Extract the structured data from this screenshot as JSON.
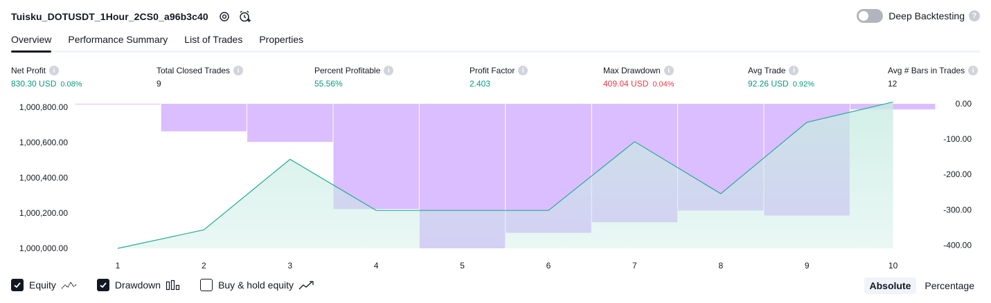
{
  "header": {
    "strategy_name": "Tuisku_DOTUSDT_1Hour_2CS0_a96b3c40",
    "deep_backtesting_label": "Deep Backtesting",
    "help_glyph": "?"
  },
  "tabs": [
    {
      "label": "Overview",
      "active": true
    },
    {
      "label": "Performance Summary",
      "active": false
    },
    {
      "label": "List of Trades",
      "active": false
    },
    {
      "label": "Properties",
      "active": false
    }
  ],
  "metrics": [
    {
      "label": "Net Profit",
      "value": "830.30 USD",
      "pct": "0.08%",
      "tone": "pos"
    },
    {
      "label": "Total Closed Trades",
      "value": "9",
      "pct": "",
      "tone": "plain"
    },
    {
      "label": "Percent Profitable",
      "value": "55.56%",
      "pct": "",
      "tone": "pos"
    },
    {
      "label": "Profit Factor",
      "value": "2.403",
      "pct": "",
      "tone": "pos"
    },
    {
      "label": "Max Drawdown",
      "value": "409.04 USD",
      "pct": "0.04%",
      "tone": "neg"
    },
    {
      "label": "Avg Trade",
      "value": "92.26 USD",
      "pct": "0.92%",
      "tone": "pos"
    },
    {
      "label": "Avg # Bars in Trades",
      "value": "12",
      "pct": "",
      "tone": "plain"
    }
  ],
  "metric_info_glyph": "i",
  "chart_data": {
    "type": "area",
    "x": [
      1,
      2,
      3,
      4,
      5,
      6,
      7,
      8,
      9,
      10
    ],
    "x_tick_labels": [
      "1",
      "2",
      "3",
      "4",
      "5",
      "6",
      "7",
      "8",
      "9",
      "10"
    ],
    "series": [
      {
        "axis": "left",
        "kind": "area-line",
        "values": [
          1000000,
          1000105,
          1000505,
          1000215,
          1000215,
          1000215,
          1000605,
          1000310,
          1000715,
          1000830
        ]
      },
      {
        "axis": "right",
        "kind": "bar",
        "values": [
          0,
          -78,
          -108,
          -298,
          -409,
          -365,
          -335,
          -302,
          -316,
          -16
        ]
      }
    ],
    "left_axis": {
      "ylim": [
        1000000,
        1000820
      ],
      "ticks": [
        1000000,
        1000200,
        1000400,
        1000600,
        1000800
      ],
      "tick_labels": [
        "1,000,000.00",
        "1,000,200.00",
        "1,000,400.00",
        "1,000,600.00",
        "1,000,800.00"
      ]
    },
    "right_axis": {
      "ylim": [
        -409,
        0
      ],
      "ticks": [
        0,
        -100,
        -200,
        -300,
        -400
      ],
      "tick_labels": [
        "0.00",
        "-100.00",
        "-200.00",
        "-300.00",
        "-400.00"
      ]
    },
    "colors": {
      "equity_line": "#22ab94",
      "equity_fill": "#c8ece2",
      "drawdown": "#cfa8ff"
    },
    "grid": false
  },
  "legend": [
    {
      "label": "Equity",
      "checked": true
    },
    {
      "label": "Drawdown",
      "checked": true
    },
    {
      "label": "Buy & hold equity",
      "checked": false
    }
  ],
  "modes": [
    {
      "label": "Absolute",
      "active": true
    },
    {
      "label": "Percentage",
      "active": false
    }
  ]
}
